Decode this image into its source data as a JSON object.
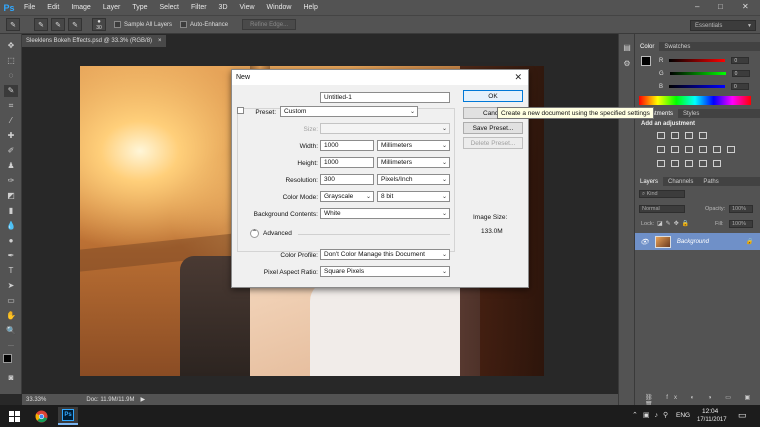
{
  "app": {
    "logo": "Ps",
    "menu": [
      "File",
      "Edit",
      "Image",
      "Layer",
      "Type",
      "Select",
      "Filter",
      "3D",
      "View",
      "Window",
      "Help"
    ],
    "workspace": "Essentials"
  },
  "options_bar": {
    "sample_all_layers": "Sample All Layers",
    "auto_enhance": "Auto-Enhance",
    "refine_edge": "Refine Edge...",
    "brush_size": "30"
  },
  "document": {
    "tab_title": "Sleeklens Bokeh Effects.psd @ 33.3% (RGB/8)",
    "zoom": "33.33%",
    "doc_size": "Doc: 11.9M/11.9M"
  },
  "new_dialog": {
    "title": "New",
    "name_label": "Name:",
    "name_value": "Untitled-1",
    "preset_label": "Preset:",
    "preset_value": "Custom",
    "size_label": "Size:",
    "width_label": "Width:",
    "width_value": "1000",
    "width_unit": "Millimeters",
    "height_label": "Height:",
    "height_value": "1000",
    "height_unit": "Millimeters",
    "resolution_label": "Resolution:",
    "resolution_value": "300",
    "resolution_unit": "Pixels/Inch",
    "color_mode_label": "Color Mode:",
    "color_mode_value": "Grayscale",
    "bit_depth": "8 bit",
    "bg_label": "Background Contents:",
    "bg_value": "White",
    "advanced_label": "Advanced",
    "color_profile_label": "Color Profile:",
    "color_profile_value": "Don't Color Manage this Document",
    "pixel_aspect_label": "Pixel Aspect Ratio:",
    "pixel_aspect_value": "Square Pixels",
    "image_size_label": "Image Size:",
    "image_size_value": "133.0M",
    "ok": "OK",
    "cancel": "Canc",
    "save_preset": "Save Preset...",
    "delete_preset": "Delete Preset...",
    "tooltip": "Create a new document using the specified settings"
  },
  "color_panel": {
    "tabs": [
      "Color",
      "Swatches"
    ],
    "r": "R",
    "g": "G",
    "b": "B",
    "r_value": "0",
    "g_value": "0",
    "b_value": "0"
  },
  "adjustments_panel": {
    "tabs": [
      "Adjustments",
      "Styles"
    ],
    "heading": "Add an adjustment"
  },
  "layers_panel": {
    "tabs": [
      "Layers",
      "Channels",
      "Paths"
    ],
    "kind": "Kind",
    "blend": "Normal",
    "opacity_label": "Opacity:",
    "opacity_value": "100%",
    "lock_label": "Lock:",
    "fill_label": "Fill:",
    "fill_value": "100%",
    "layer_name": "Background"
  },
  "taskbar": {
    "lang": "ENG",
    "time": "12:04",
    "date": "17/11/2017"
  },
  "colors": {
    "accent": "#0078d7",
    "ps_blue": "#31a8ff",
    "layer_selected": "#6f90c8"
  }
}
